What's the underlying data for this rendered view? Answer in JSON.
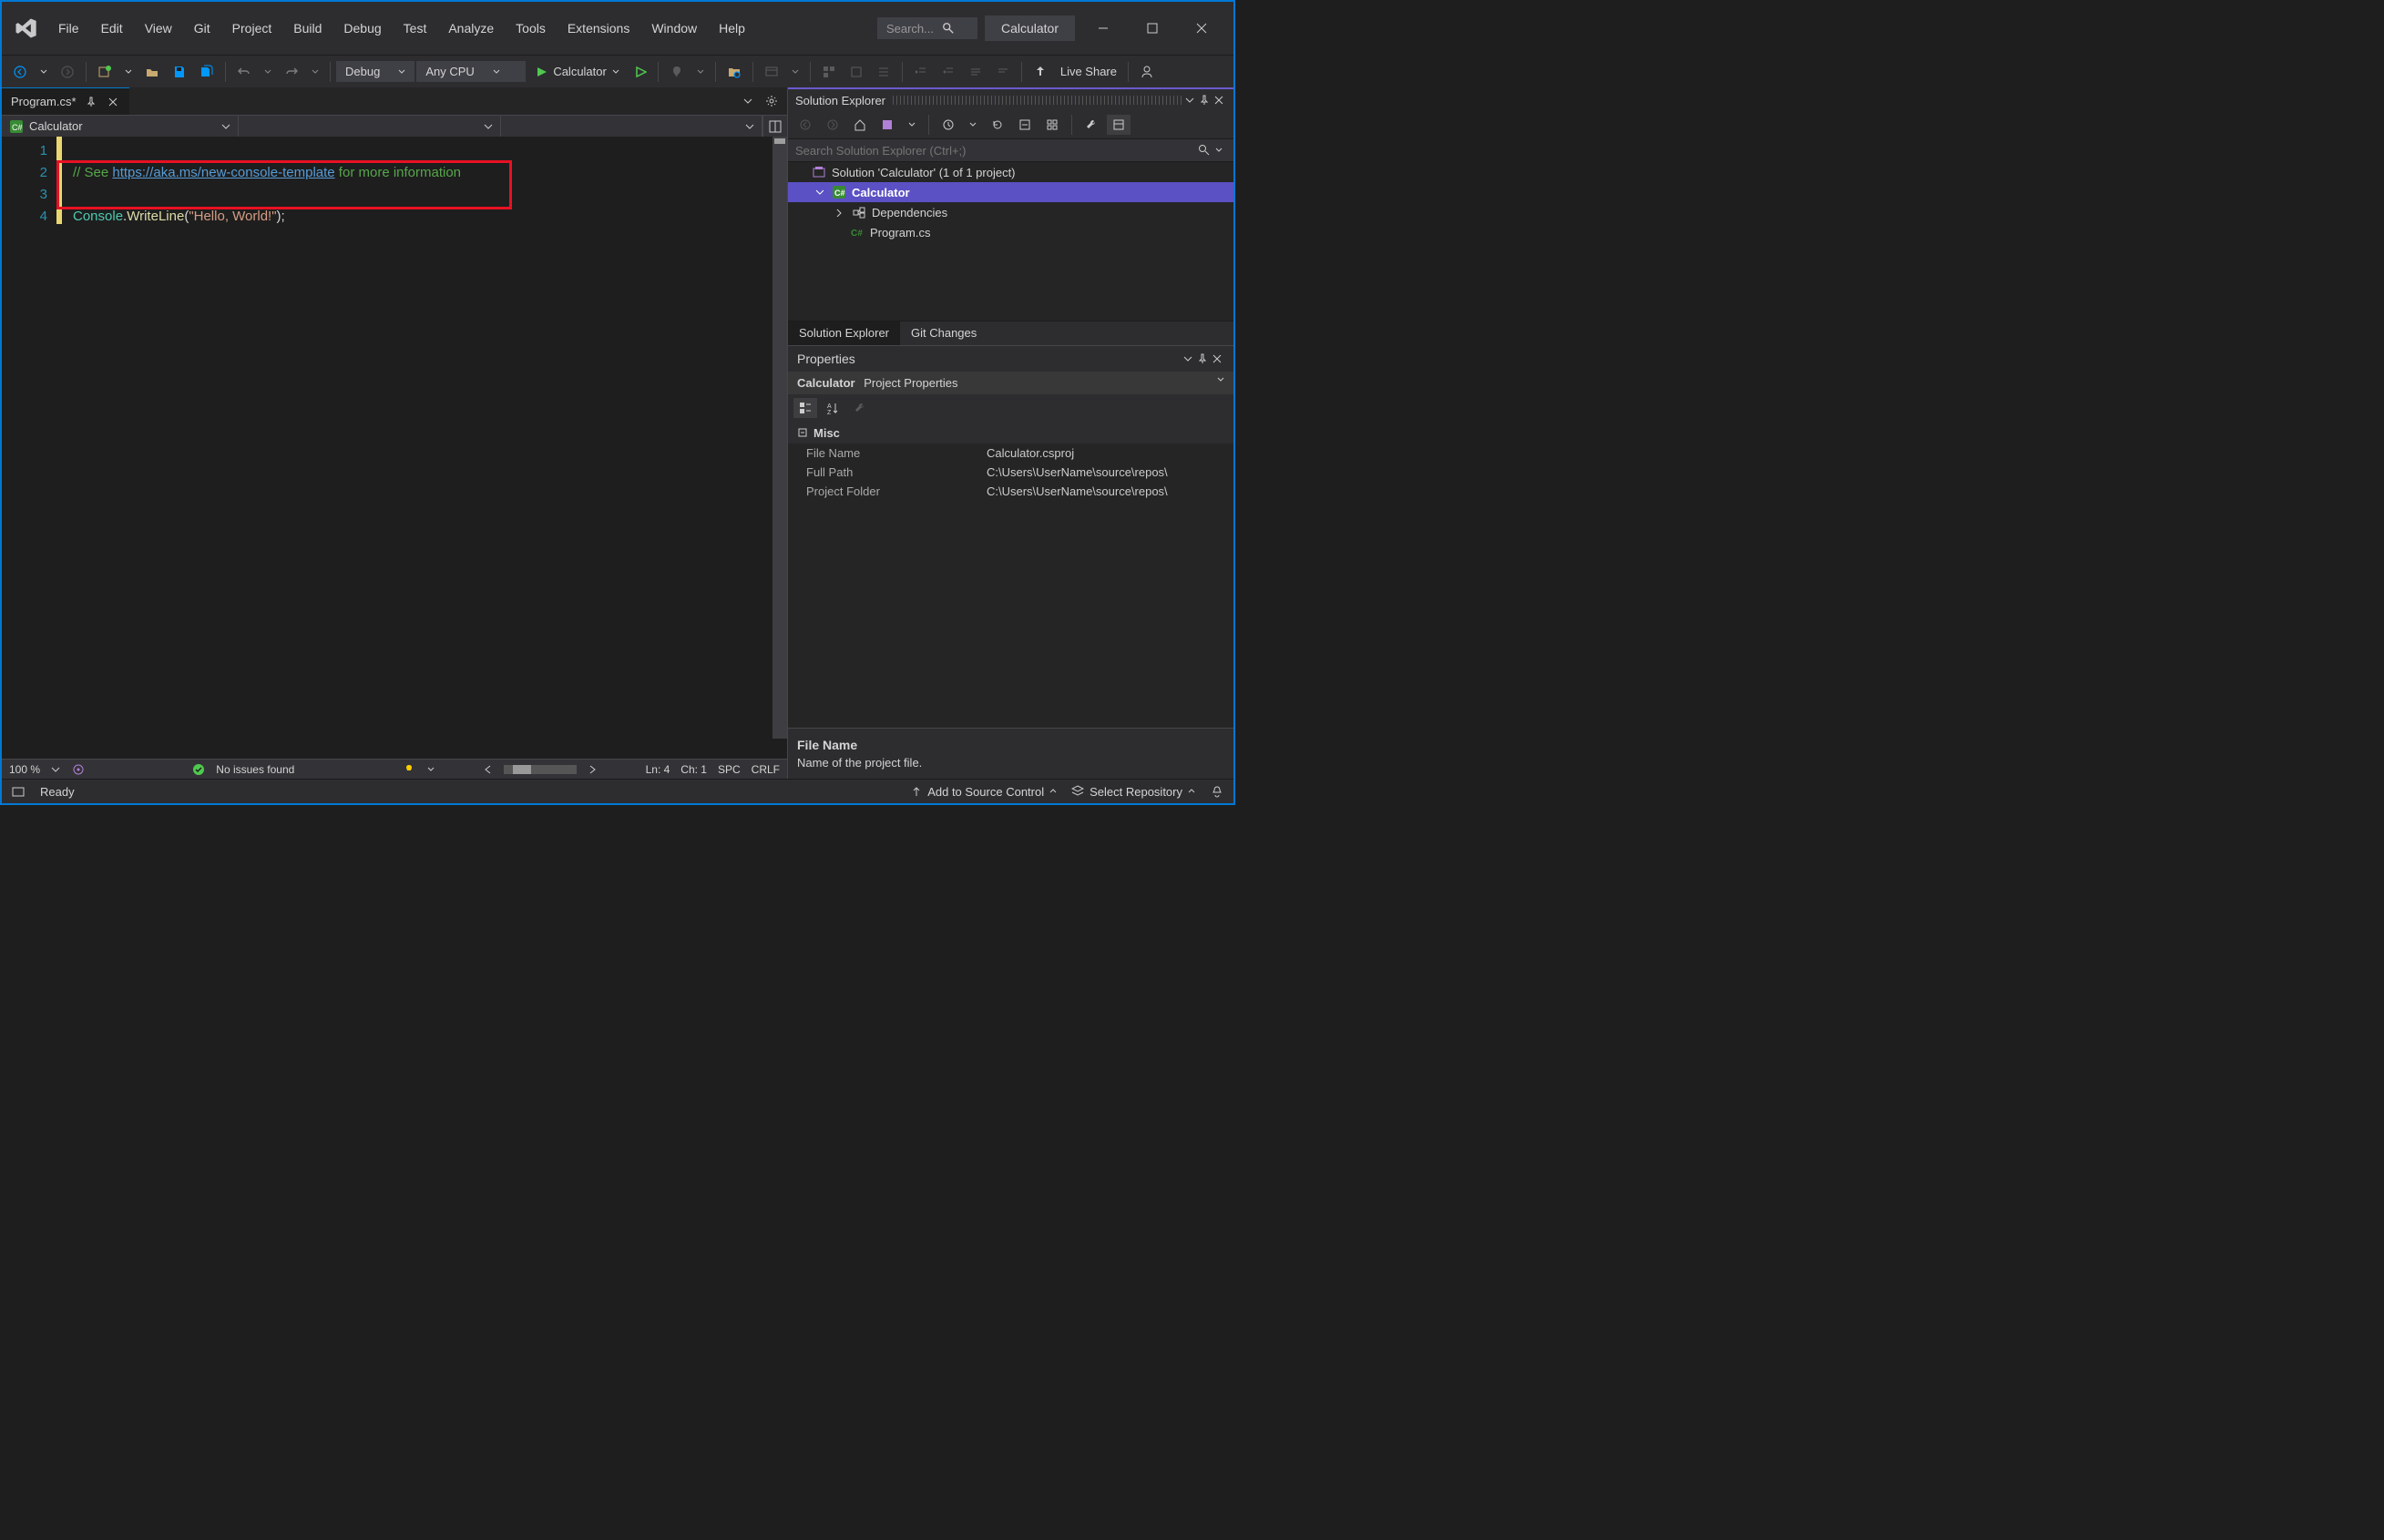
{
  "menus": [
    "File",
    "Edit",
    "View",
    "Git",
    "Project",
    "Build",
    "Debug",
    "Test",
    "Analyze",
    "Tools",
    "Extensions",
    "Window",
    "Help"
  ],
  "titlebar": {
    "search_placeholder": "Search...",
    "app_title": "Calculator"
  },
  "toolbar": {
    "config": "Debug",
    "platform": "Any CPU",
    "start_target": "Calculator",
    "live_share": "Live Share"
  },
  "tab": {
    "name": "Program.cs*",
    "pinned": false
  },
  "navbar": {
    "scope": "Calculator"
  },
  "code": {
    "lines": [
      "1",
      "2",
      "3",
      "4"
    ],
    "comment_prefix": "// See ",
    "link": "https://aka.ms/new-console-template",
    "comment_suffix": " for more information",
    "type": "Console",
    "method": "WriteLine",
    "string": "\"Hello, World!\""
  },
  "editor_status": {
    "zoom": "100 %",
    "issues": "No issues found",
    "ln": "Ln: 4",
    "ch": "Ch: 1",
    "spc": "SPC",
    "crlf": "CRLF"
  },
  "solution_explorer": {
    "title": "Solution Explorer",
    "search_placeholder": "Search Solution Explorer (Ctrl+;)",
    "root": "Solution 'Calculator' (1 of 1 project)",
    "project": "Calculator",
    "dependencies": "Dependencies",
    "program": "Program.cs",
    "tabs": [
      "Solution Explorer",
      "Git Changes"
    ]
  },
  "properties": {
    "title": "Properties",
    "subject": "Calculator",
    "subject_type": "Project Properties",
    "category": "Misc",
    "rows": [
      {
        "k": "File Name",
        "v": "Calculator.csproj"
      },
      {
        "k": "Full Path",
        "v": "C:\\Users\\UserName\\source\\repos\\"
      },
      {
        "k": "Project Folder",
        "v": "C:\\Users\\UserName\\source\\repos\\"
      }
    ],
    "desc_title": "File Name",
    "desc_text": "Name of the project file."
  },
  "statusbar": {
    "ready": "Ready",
    "add_source": "Add to Source Control",
    "select_repo": "Select Repository"
  }
}
